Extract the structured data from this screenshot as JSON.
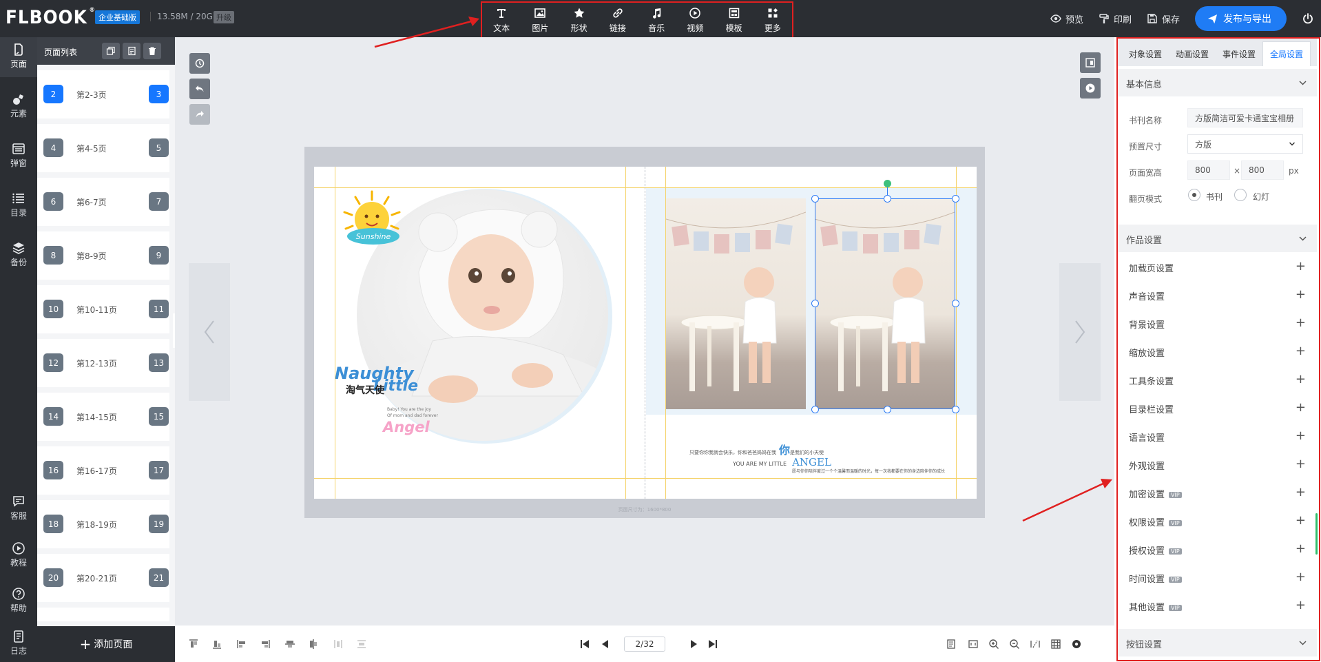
{
  "header": {
    "logo": "FLBOOK",
    "edition": "企业基础版",
    "storage": "13.58M / 20G",
    "upgrade": "升级",
    "tools": [
      {
        "label": "文本",
        "icon": "text-icon"
      },
      {
        "label": "图片",
        "icon": "image-icon"
      },
      {
        "label": "形状",
        "icon": "star-shape-icon"
      },
      {
        "label": "链接",
        "icon": "link-icon"
      },
      {
        "label": "音乐",
        "icon": "music-icon"
      },
      {
        "label": "视频",
        "icon": "video-icon"
      },
      {
        "label": "模板",
        "icon": "template-icon"
      },
      {
        "label": "更多",
        "icon": "more-apps-icon"
      }
    ],
    "preview": "预览",
    "print": "印刷",
    "save": "保存",
    "publish": "发布与导出"
  },
  "rail": {
    "items": [
      {
        "label": "页面",
        "icon": "page-icon"
      },
      {
        "label": "元素",
        "icon": "elements-icon"
      },
      {
        "label": "弹窗",
        "icon": "popup-icon"
      },
      {
        "label": "目录",
        "icon": "toc-icon"
      },
      {
        "label": "备份",
        "icon": "layers-icon"
      },
      {
        "label": "客服",
        "icon": "chat-icon"
      },
      {
        "label": "教程",
        "icon": "play-circle-icon"
      },
      {
        "label": "帮助",
        "icon": "help-icon"
      },
      {
        "label": "日志",
        "icon": "log-icon"
      }
    ]
  },
  "pagelist": {
    "title": "页面列表",
    "add_page": "添加页面",
    "items": [
      {
        "left": "2",
        "right": "3",
        "label": "第2-3页"
      },
      {
        "left": "4",
        "right": "5",
        "label": "第4-5页"
      },
      {
        "left": "6",
        "right": "7",
        "label": "第6-7页"
      },
      {
        "left": "8",
        "right": "9",
        "label": "第8-9页"
      },
      {
        "left": "10",
        "right": "11",
        "label": "第10-11页"
      },
      {
        "left": "12",
        "right": "13",
        "label": "第12-13页"
      },
      {
        "left": "14",
        "right": "15",
        "label": "第14-15页"
      },
      {
        "left": "16",
        "right": "17",
        "label": "第16-17页"
      },
      {
        "left": "18",
        "right": "19",
        "label": "第18-19页"
      },
      {
        "left": "20",
        "right": "21",
        "label": "第20-21页"
      }
    ]
  },
  "canvas": {
    "caption": "页面尺寸为：1600*800",
    "sunshine": "Sunshine",
    "naughty": "Naughty",
    "little": "Little",
    "cn_title": "淘气天使",
    "small_1": "Baby! You are the joy",
    "small_2": "Of mom and dad forever",
    "angel": "Angel",
    "line1": "只要你你我就会快乐，你和爸爸妈妈在我",
    "ni": "你",
    "line1b": "是我们的小天使",
    "you_are": "YOU ARE MY LITTLE",
    "angel_big": "ANGEL",
    "line2": "愿与你你陪伴度过一个个温馨而温暖的时光，每一次我都要在你的身边陪伴你的成长"
  },
  "pager": {
    "value": "2/32"
  },
  "rightpanel": {
    "tabs": [
      "对象设置",
      "动画设置",
      "事件设置",
      "全局设置"
    ],
    "basic_title": "基本信息",
    "book_name_label": "书刊名称",
    "book_name_value": "方版简洁可爱卡通宝宝相册",
    "preset_label": "预置尺寸",
    "preset_value": "方版",
    "size_label": "页面宽高",
    "width": "800",
    "height": "800",
    "times": "×",
    "unit": "px",
    "mode_label": "翻页模式",
    "mode_book": "书刊",
    "mode_slide": "幻灯",
    "works_title": "作品设置",
    "rows": [
      {
        "label": "加载页设置",
        "vip": ""
      },
      {
        "label": "声音设置",
        "vip": ""
      },
      {
        "label": "背景设置",
        "vip": ""
      },
      {
        "label": "缩放设置",
        "vip": ""
      },
      {
        "label": "工具条设置",
        "vip": ""
      },
      {
        "label": "目录栏设置",
        "vip": ""
      },
      {
        "label": "语言设置",
        "vip": ""
      },
      {
        "label": "外观设置",
        "vip": ""
      },
      {
        "label": "加密设置",
        "vip": "VIP"
      },
      {
        "label": "权限设置",
        "vip": "VIP"
      },
      {
        "label": "授权设置",
        "vip": "VIP"
      },
      {
        "label": "时间设置",
        "vip": "VIP"
      },
      {
        "label": "其他设置",
        "vip": "VIP"
      }
    ],
    "button_title": "按钮设置"
  }
}
